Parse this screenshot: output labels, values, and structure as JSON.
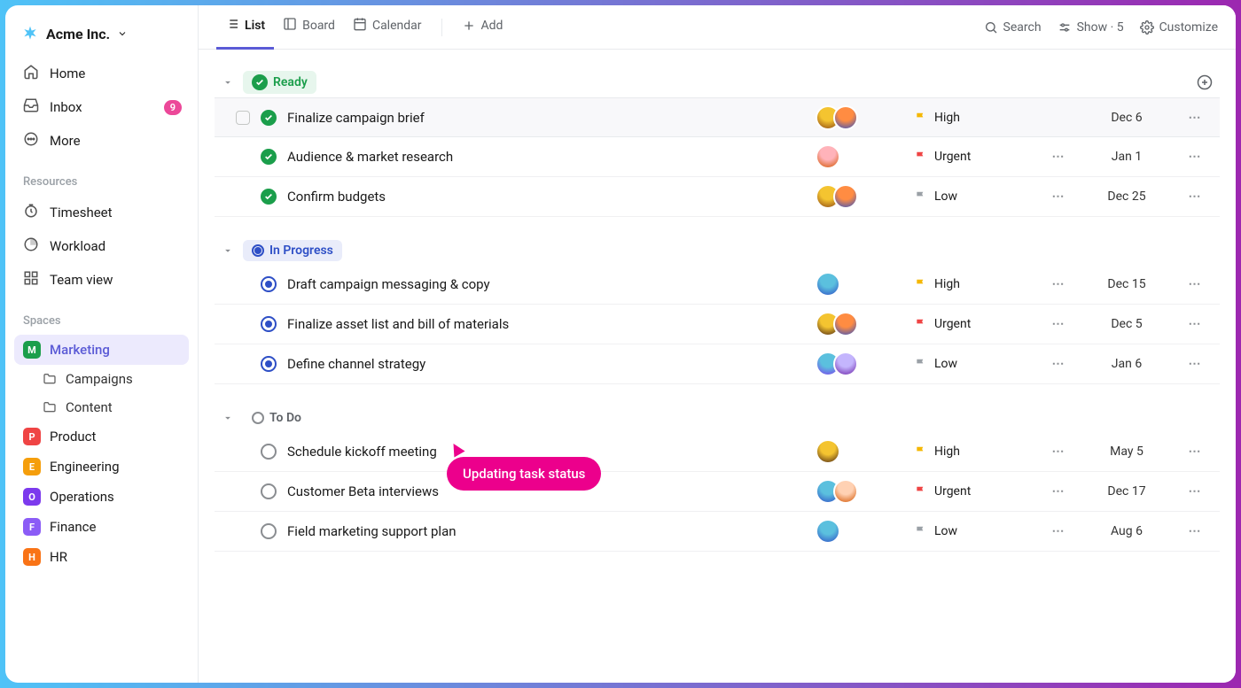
{
  "workspace": {
    "name": "Acme Inc."
  },
  "sidebar": {
    "nav": [
      {
        "label": "Home",
        "icon": "home"
      },
      {
        "label": "Inbox",
        "icon": "inbox",
        "badge": "9"
      },
      {
        "label": "More",
        "icon": "more"
      }
    ],
    "resources_label": "Resources",
    "resources": [
      {
        "label": "Timesheet",
        "icon": "timesheet"
      },
      {
        "label": "Workload",
        "icon": "workload"
      },
      {
        "label": "Team view",
        "icon": "teamview"
      }
    ],
    "spaces_label": "Spaces",
    "spaces": [
      {
        "initial": "M",
        "label": "Marketing",
        "color": "#1b9e4b",
        "active": true,
        "children": [
          {
            "label": "Campaigns"
          },
          {
            "label": "Content"
          }
        ]
      },
      {
        "initial": "P",
        "label": "Product",
        "color": "#ef4444"
      },
      {
        "initial": "E",
        "label": "Engineering",
        "color": "#f59e0b"
      },
      {
        "initial": "O",
        "label": "Operations",
        "color": "#7c3aed"
      },
      {
        "initial": "F",
        "label": "Finance",
        "color": "#8b5cf6"
      },
      {
        "initial": "H",
        "label": "HR",
        "color": "#f97316"
      }
    ]
  },
  "toolbar": {
    "views": [
      {
        "label": "List",
        "icon": "list",
        "active": true
      },
      {
        "label": "Board",
        "icon": "board"
      },
      {
        "label": "Calendar",
        "icon": "calendar"
      }
    ],
    "add_label": "Add",
    "search_label": "Search",
    "show_label": "Show · 5",
    "customize_label": "Customize"
  },
  "groups": [
    {
      "name": "Ready",
      "color": "#1b9e4b",
      "bg": "#e7f6ed",
      "kind": "done",
      "tasks": [
        {
          "title": "Finalize campaign brief",
          "avatars": [
            [
              "#f4c430",
              "#8b4513"
            ],
            [
              "#ff8c42",
              "#2e4fc6"
            ]
          ],
          "priority": "High",
          "flag": "#f5b700",
          "date": "Dec 6",
          "hovered": true
        },
        {
          "title": "Audience & market research",
          "avatars": [
            [
              "#ffb3ba",
              "#d35400"
            ]
          ],
          "priority": "Urgent",
          "flag": "#ef4444",
          "date": "Jan 1",
          "subtasks": true
        },
        {
          "title": "Confirm budgets",
          "avatars": [
            [
              "#f4c430",
              "#8b4513"
            ],
            [
              "#ff8c42",
              "#2e4fc6"
            ]
          ],
          "priority": "Low",
          "flag": "#9aa0a6",
          "date": "Dec 25",
          "subtasks": true
        }
      ]
    },
    {
      "name": "In Progress",
      "color": "#2e4fc6",
      "bg": "#e9ecfa",
      "kind": "inprog",
      "tasks": [
        {
          "title": "Draft campaign messaging & copy",
          "avatars": [
            [
              "#5bc0de",
              "#2e4fc6"
            ]
          ],
          "priority": "High",
          "flag": "#f5b700",
          "date": "Dec 15",
          "subtasks": true
        },
        {
          "title": "Finalize asset list and bill of materials",
          "avatars": [
            [
              "#f4c430",
              "#4a2511"
            ],
            [
              "#ff8c42",
              "#2e4fc6"
            ]
          ],
          "priority": "Urgent",
          "flag": "#ef4444",
          "date": "Dec 5",
          "subtasks": true
        },
        {
          "title": "Define channel strategy",
          "avatars": [
            [
              "#5bc0de",
              "#7c3aed"
            ],
            [
              "#c4b5fd",
              "#6b21a8"
            ]
          ],
          "priority": "Low",
          "flag": "#9aa0a6",
          "date": "Jan 6",
          "subtasks": true
        }
      ]
    },
    {
      "name": "To Do",
      "color": "#5f6368",
      "bg": "transparent",
      "kind": "todo",
      "tasks": [
        {
          "title": "Schedule kickoff meeting",
          "avatars": [
            [
              "#f4c430",
              "#4a2511"
            ]
          ],
          "priority": "High",
          "flag": "#f5b700",
          "date": "May 5",
          "subtasks": true
        },
        {
          "title": "Customer Beta interviews",
          "avatars": [
            [
              "#5bc0de",
              "#2e4fc6"
            ],
            [
              "#ffd1b3",
              "#d35400"
            ]
          ],
          "priority": "Urgent",
          "flag": "#ef4444",
          "date": "Dec 17",
          "subtasks": true
        },
        {
          "title": "Field marketing support plan",
          "avatars": [
            [
              "#5bc0de",
              "#2e4fc6"
            ]
          ],
          "priority": "Low",
          "flag": "#9aa0a6",
          "date": "Aug 6",
          "subtasks": true
        }
      ]
    }
  ],
  "tooltip": "Updating task status"
}
